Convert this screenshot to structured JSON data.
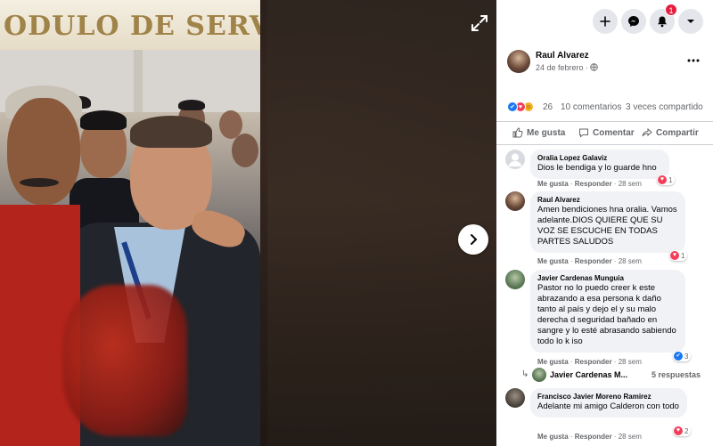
{
  "photo": {
    "sign_text": "ODULO DE SERVI"
  },
  "post": {
    "author": "Raul Alvarez",
    "date": "24 de febrero ·",
    "reaction_count": "26",
    "comments_count": "10 comentarios",
    "shares_count": "3 veces compartido"
  },
  "actions": {
    "like": "Me gusta",
    "comment": "Comentar",
    "share": "Compartir"
  },
  "notifications": {
    "badge": "1"
  },
  "comments": [
    {
      "name": "Oralia Lopez Galaviz",
      "text": "Dios le bendiga y lo guarde hno",
      "like": "Me gusta",
      "reply": "Responder",
      "age": "28 sem",
      "reactions": "1"
    },
    {
      "name": "Raul Alvarez",
      "text": "Amen bendiciones hna oralia. Vamos adelante.DIOS QUIERE QUE SU VOZ SE ESCUCHE EN TODAS PARTES SALUDOS",
      "like": "Me gusta",
      "reply": "Responder",
      "age": "28 sem",
      "reactions": "1"
    },
    {
      "name": "Javier Cardenas Munguia",
      "text": "Pastor no lo puedo creer k este abrazando a esa persona k daño tanto al país y dejo el y su malo derecha d seguridad bañado en sangre y lo esté abrasando sabiendo todo lo k iso",
      "like": "Me gusta",
      "reply": "Responder",
      "age": "28 sem",
      "reactions": "3"
    },
    {
      "name": "Francisco Javier Moreno Ramirez",
      "text": "Adelante mi amigo Calderon con todo",
      "like": "Me gusta",
      "reply": "Responder",
      "age": "28 sem",
      "reactions": "2"
    }
  ],
  "reply_thread": {
    "name": "Javier Cardenas M...",
    "count": "5 respuestas"
  },
  "colors": {
    "accent": "#1877f2",
    "heart": "#f33e58",
    "bubble": "#f0f2f5",
    "secondary_text": "#65676b"
  }
}
